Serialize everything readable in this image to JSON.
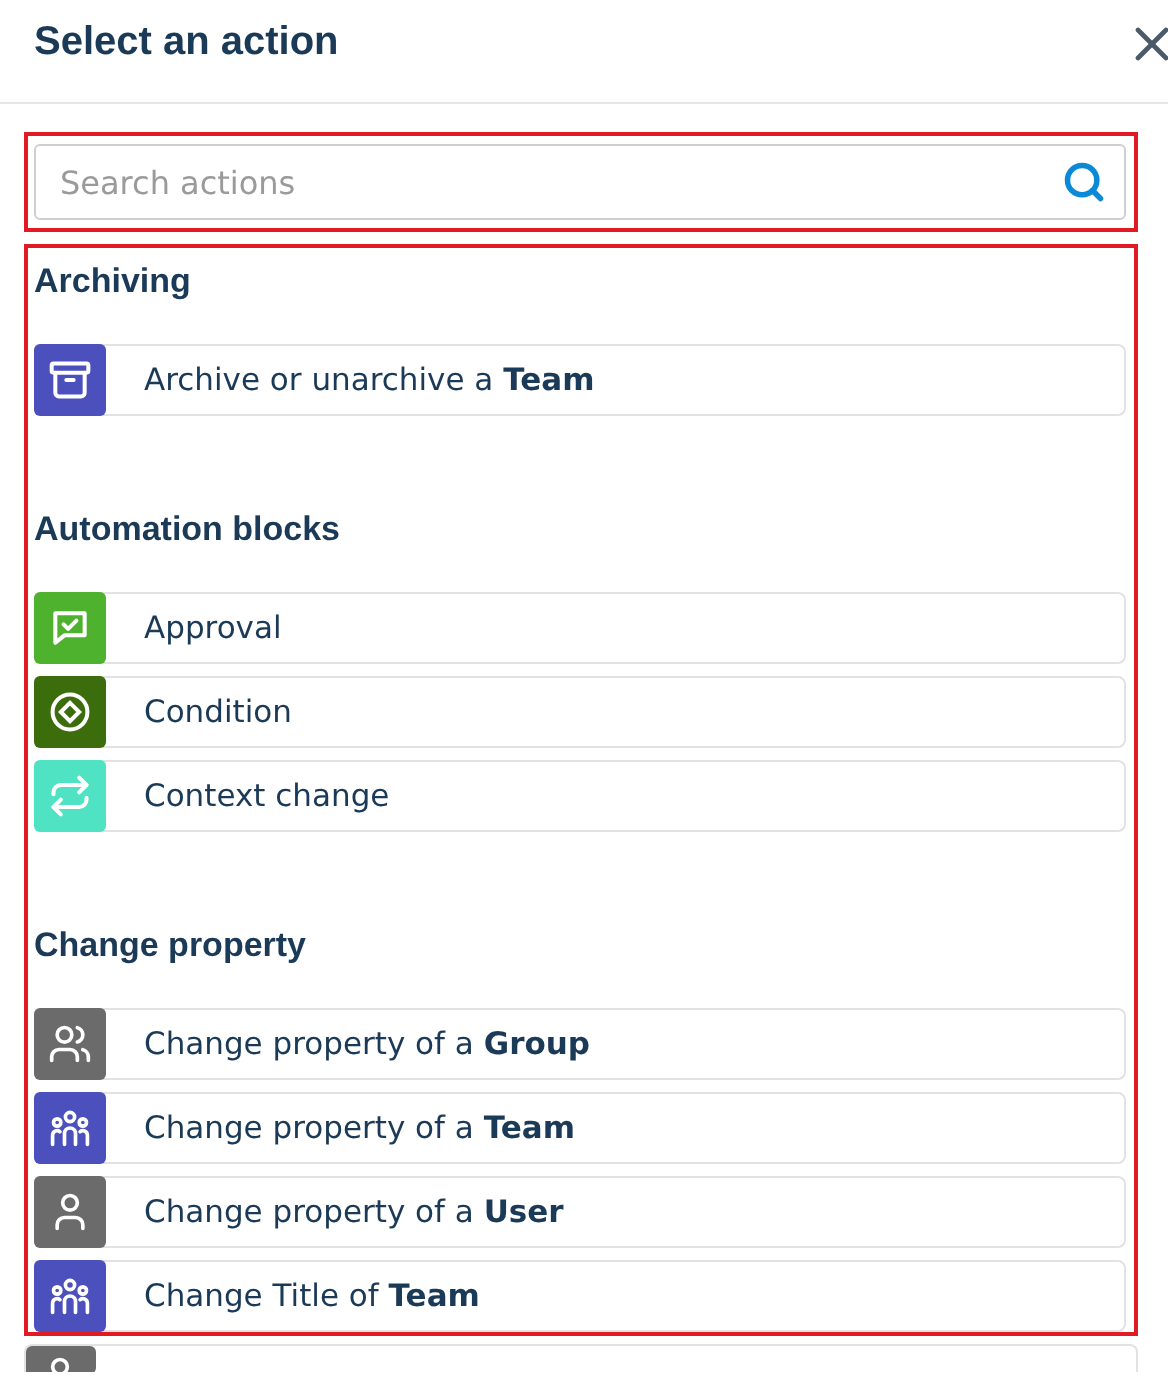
{
  "dialog": {
    "title": "Select an action"
  },
  "search": {
    "placeholder": "Search actions"
  },
  "sections": [
    {
      "title": "Archiving",
      "items": [
        {
          "kind": "archive",
          "color": "#4b50bd",
          "text": "Archive or unarchive a **Team**"
        }
      ]
    },
    {
      "title": "Automation blocks",
      "items": [
        {
          "kind": "approval",
          "color": "#4fb22e",
          "text": "Approval"
        },
        {
          "kind": "condition",
          "color": "#3b6d0c",
          "text": "Condition"
        },
        {
          "kind": "context",
          "color": "#4fe3c3",
          "text": "Context change"
        }
      ]
    },
    {
      "title": "Change property",
      "items": [
        {
          "kind": "group",
          "color": "#6b6b6b",
          "text": "Change property of a **Group**"
        },
        {
          "kind": "team",
          "color": "#4b50bd",
          "text": "Change property of a **Team**"
        },
        {
          "kind": "user",
          "color": "#6b6b6b",
          "text": "Change property of a **User**"
        },
        {
          "kind": "team",
          "color": "#4b50bd",
          "text": "Change Title of **Team**"
        }
      ]
    }
  ],
  "cut_off_item": {
    "kind": "user",
    "color": "#6b6b6b"
  }
}
